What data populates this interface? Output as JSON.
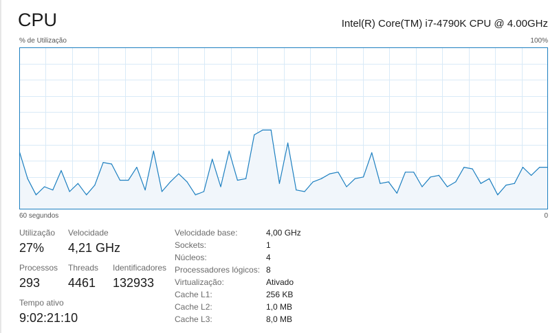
{
  "header": {
    "title": "CPU",
    "model": "Intel(R) Core(TM) i7-4790K CPU @ 4.00GHz"
  },
  "graph": {
    "y_label": "% de Utilização",
    "y_max_label": "100%",
    "x_label_left": "60 segundos",
    "x_label_right": "0",
    "colors": {
      "line": "#1c7fc0",
      "fill": "#f1f6fb",
      "grid": "#d9eaf7",
      "border": "#1c7fc0"
    }
  },
  "chart_data": {
    "type": "area",
    "ylim": [
      0,
      100
    ],
    "values": [
      36,
      19,
      9,
      14,
      12,
      24,
      11,
      16,
      9,
      15,
      29,
      28,
      18,
      18,
      26,
      12,
      36,
      11,
      17,
      22,
      17,
      9,
      11,
      31,
      14,
      36,
      18,
      19,
      46,
      49,
      49,
      16,
      41,
      12,
      11,
      17,
      19,
      22,
      23,
      14,
      19,
      20,
      35,
      16,
      17,
      10,
      23,
      23,
      14,
      20,
      21,
      14,
      17,
      26,
      25,
      16,
      19,
      9,
      15,
      16,
      26,
      21,
      26,
      26
    ]
  },
  "stats": {
    "utilization": {
      "label": "Utilização",
      "value": "27%"
    },
    "speed": {
      "label": "Velocidade",
      "value": "4,21 GHz"
    },
    "processes": {
      "label": "Processos",
      "value": "293"
    },
    "threads": {
      "label": "Threads",
      "value": "4461"
    },
    "handles": {
      "label": "Identificadores",
      "value": "132933"
    },
    "uptime": {
      "label": "Tempo ativo",
      "value": "9:02:21:10"
    }
  },
  "specs": [
    {
      "key": "Velocidade base:",
      "value": "4,00 GHz"
    },
    {
      "key": "Sockets:",
      "value": "1"
    },
    {
      "key": "Núcleos:",
      "value": "4"
    },
    {
      "key": "Processadores lógicos:",
      "value": "8"
    },
    {
      "key": "Virtualização:",
      "value": "Ativado"
    },
    {
      "key": "Cache L1:",
      "value": "256 KB"
    },
    {
      "key": "Cache L2:",
      "value": "1,0 MB"
    },
    {
      "key": "Cache L3:",
      "value": "8,0 MB"
    }
  ]
}
